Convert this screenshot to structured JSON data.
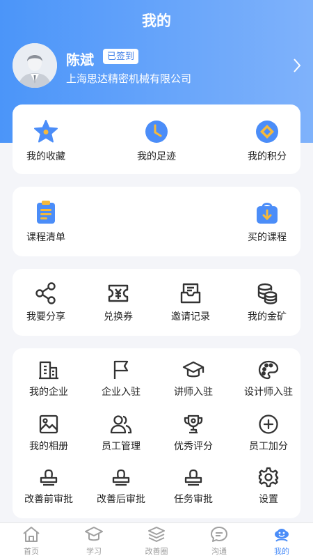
{
  "header": {
    "title": "我的"
  },
  "profile": {
    "name": "陈斌",
    "badge": "已签到",
    "company": "上海思达精密机械有限公司"
  },
  "section1": [
    {
      "label": "我的收藏",
      "icon": "star-icon"
    },
    {
      "label": "我的足迹",
      "icon": "clock-icon"
    },
    {
      "label": "我的积分",
      "icon": "points-icon"
    }
  ],
  "section2": [
    {
      "label": "课程清单",
      "icon": "clipboard-icon"
    },
    {
      "label": "买的课程",
      "icon": "bag-icon"
    }
  ],
  "section3": [
    {
      "label": "我要分享",
      "icon": "share-icon"
    },
    {
      "label": "兑换券",
      "icon": "coupon-icon"
    },
    {
      "label": "邀请记录",
      "icon": "invite-record-icon"
    },
    {
      "label": "我的金矿",
      "icon": "coins-icon"
    }
  ],
  "section4": [
    {
      "label": "我的企业",
      "icon": "building-icon"
    },
    {
      "label": "企业入驻",
      "icon": "flag-icon"
    },
    {
      "label": "讲师入驻",
      "icon": "graduation-cap-icon"
    },
    {
      "label": "设计师入驻",
      "icon": "palette-icon"
    },
    {
      "label": "我的相册",
      "icon": "image-icon"
    },
    {
      "label": "员工管理",
      "icon": "users-icon"
    },
    {
      "label": "优秀评分",
      "icon": "trophy-icon"
    },
    {
      "label": "员工加分",
      "icon": "plus-circle-icon"
    },
    {
      "label": "改善前审批",
      "icon": "stamp-icon"
    },
    {
      "label": "改善后审批",
      "icon": "stamp-icon"
    },
    {
      "label": "任务审批",
      "icon": "stamp-icon"
    },
    {
      "label": "设置",
      "icon": "gear-icon"
    }
  ],
  "tabbar": {
    "active_color": "#4b8df8",
    "items": [
      {
        "label": "首页",
        "icon": "home-icon"
      },
      {
        "label": "学习",
        "icon": "learn-icon"
      },
      {
        "label": "改善圈",
        "icon": "layers-icon"
      },
      {
        "label": "沟通",
        "icon": "chat-icon"
      },
      {
        "label": "我的",
        "icon": "profile-icon"
      }
    ]
  }
}
